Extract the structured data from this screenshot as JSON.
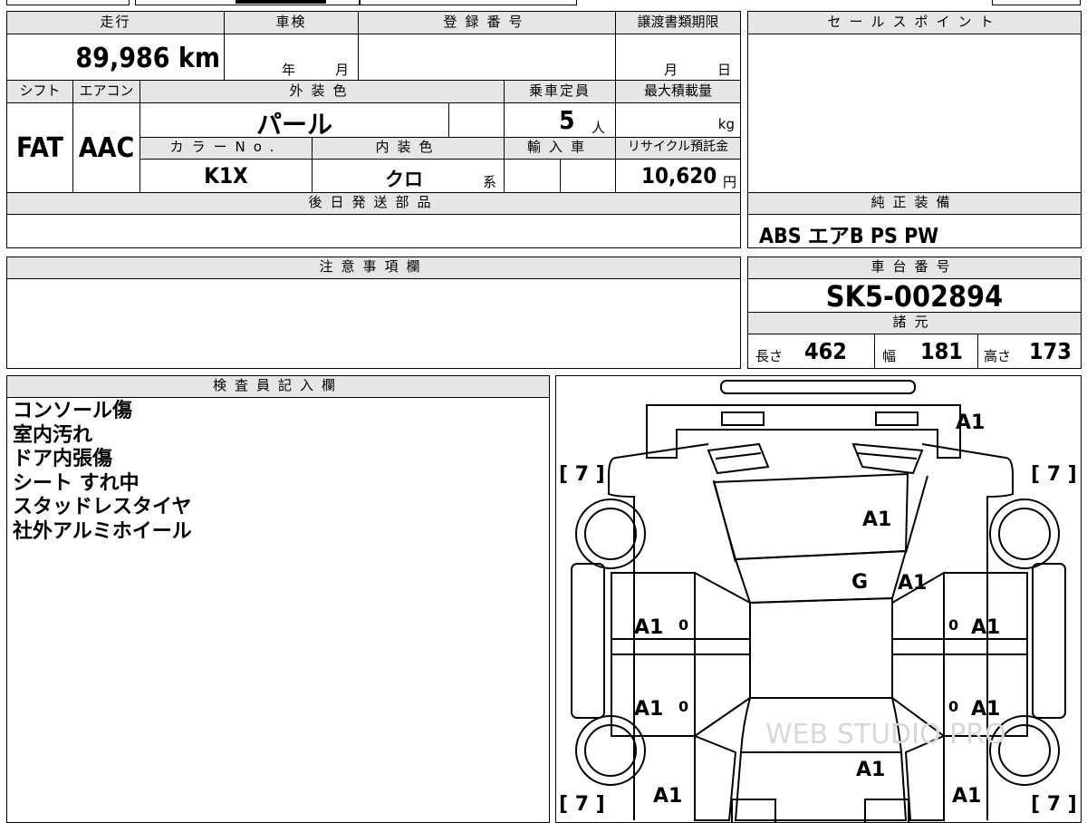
{
  "mileage": {
    "label": "走行",
    "value": "89,986 km"
  },
  "inspection": {
    "label": "車検",
    "year_unit": "年",
    "month_unit": "月"
  },
  "registration": {
    "label": "登録番号",
    "value": ""
  },
  "transfer_deadline": {
    "label": "譲渡書類期限",
    "month_unit": "月",
    "day_unit": "日"
  },
  "sale_point": {
    "label": "セールスポイント",
    "value": ""
  },
  "shift": {
    "label": "シフト",
    "value": "FAT"
  },
  "aircon": {
    "label": "エアコン",
    "value": "AAC"
  },
  "exterior_color": {
    "label": "外装色",
    "value": "パール"
  },
  "capacity": {
    "label": "乗車定員",
    "value": "5",
    "unit": "人"
  },
  "max_load": {
    "label": "最大積載量",
    "unit": "kg"
  },
  "color_no": {
    "label": "カラーNo.",
    "value": "K1X"
  },
  "interior_color": {
    "label": "内装色",
    "value": "クロ",
    "suffix": "系"
  },
  "import": {
    "label": "輸入車"
  },
  "recycle_fee": {
    "label": "リサイクル預託金",
    "value": "10,620",
    "unit": "円"
  },
  "later_parts": {
    "label": "後日発送部品",
    "value": ""
  },
  "equipment": {
    "label": "純正装備",
    "value": "ABS エアB PS PW"
  },
  "caution": {
    "label": "注意事項欄",
    "value": ""
  },
  "chassis": {
    "label": "車台番号",
    "value": "SK5-002894"
  },
  "specs": {
    "label": "諸元",
    "length_label": "長さ",
    "length": "462",
    "width_label": "幅",
    "width": "181",
    "height_label": "高さ",
    "height": "173"
  },
  "inspector": {
    "label": "検査員記入欄",
    "notes": [
      "コンソール傷",
      "室内汚れ",
      "ドア内張傷",
      "シート すれ中",
      "スタッドレスタイヤ",
      "社外アルミホイール"
    ]
  },
  "damage_map": {
    "tire_marks": [
      "[ 7 ]",
      "[ 7 ]",
      "[ 7 ]",
      "[ 7 ]"
    ],
    "codes": {
      "rear_bumper": "A1",
      "roof": "A1",
      "windshield": "G",
      "windshield_side": "A1",
      "left_rear_door": "A1",
      "right_rear_door": "A1",
      "left_front_door": "A1",
      "right_front_door": "A1",
      "hood": "A1",
      "left_fender": "A1",
      "right_fender": "A1"
    },
    "zero_marks": [
      "0",
      "0",
      "0",
      "0"
    ],
    "watermark": "WEB STUDIO PRO"
  }
}
